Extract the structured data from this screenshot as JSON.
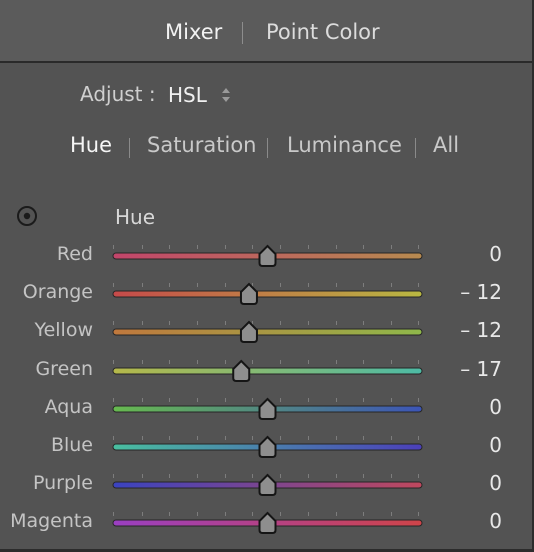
{
  "header": {
    "tabs": [
      {
        "label": "Mixer",
        "active": true
      },
      {
        "label": "Point Color",
        "active": false
      }
    ]
  },
  "adjust": {
    "label": "Adjust :",
    "value": "HSL"
  },
  "subtabs": [
    {
      "label": "Hue",
      "active": true
    },
    {
      "label": "Saturation",
      "active": false
    },
    {
      "label": "Luminance",
      "active": false
    },
    {
      "label": "All",
      "active": false
    }
  ],
  "section": {
    "label": "Hue",
    "target_icon": "target-adjust-icon"
  },
  "slider_range": [
    -100,
    100
  ],
  "sliders": [
    {
      "label": "Red",
      "value": "0",
      "numeric": 0,
      "colors": [
        "#c2456b",
        "#b78a4f"
      ]
    },
    {
      "label": "Orange",
      "value": "– 12",
      "numeric": -12,
      "colors": [
        "#c64a4a",
        "#b9b842"
      ]
    },
    {
      "label": "Yellow",
      "value": "– 12",
      "numeric": -12,
      "colors": [
        "#c0783d",
        "#8fb84a"
      ]
    },
    {
      "label": "Green",
      "value": "– 17",
      "numeric": -17,
      "colors": [
        "#b5b84a",
        "#4dbba5"
      ]
    },
    {
      "label": "Aqua",
      "value": "0",
      "numeric": 0,
      "colors": [
        "#67ba4f",
        "#3c55b7"
      ]
    },
    {
      "label": "Blue",
      "value": "0",
      "numeric": 0,
      "colors": [
        "#49bfa0",
        "#4b3fba"
      ]
    },
    {
      "label": "Purple",
      "value": "0",
      "numeric": 0,
      "colors": [
        "#3a43c0",
        "#c0485e"
      ]
    },
    {
      "label": "Magenta",
      "value": "0",
      "numeric": 0,
      "colors": [
        "#9a3fc2",
        "#cf4449"
      ]
    }
  ]
}
